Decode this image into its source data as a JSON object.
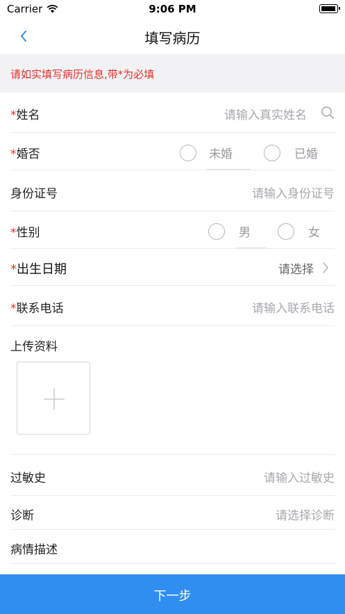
{
  "status_bar": {
    "carrier": "Carrier",
    "time": "9:06 PM"
  },
  "nav": {
    "title": "填写病历"
  },
  "notice": {
    "text": "请如实填写病历信息,带*为必填"
  },
  "required_mark": "*",
  "form": {
    "name": {
      "label": "姓名",
      "placeholder": "请输入真实姓名"
    },
    "marital": {
      "label": "婚否",
      "option1": "未婚",
      "option2": "已婚"
    },
    "id_number": {
      "label": "身份证号",
      "placeholder": "请输入身份证号"
    },
    "gender": {
      "label": "性别",
      "option1": "男",
      "option2": "女"
    },
    "birthdate": {
      "label": "出生日期",
      "placeholder": "请选择"
    },
    "phone": {
      "label": "联系电话",
      "placeholder": "请输入联系电话"
    },
    "upload": {
      "label": "上传资料"
    },
    "allergy": {
      "label": "过敏史",
      "placeholder": "请输入过敏史"
    },
    "diagnosis": {
      "label": "诊断",
      "placeholder": "请选择诊断"
    },
    "description": {
      "label": "病情描述"
    }
  },
  "footer": {
    "next_label": "下一步"
  },
  "colors": {
    "accent": "#2f8ef0",
    "required": "#e0332a",
    "placeholder": "#a8a8ae"
  }
}
